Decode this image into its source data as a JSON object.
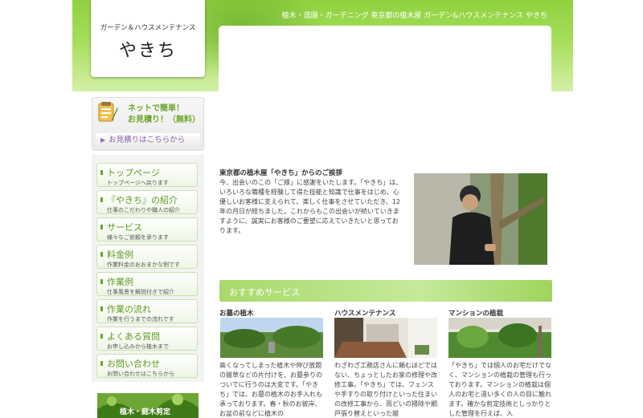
{
  "header": {
    "tagline": "植木・造園・ガーデニング 東京都の植木屋 ガーデン&ハウスメンテナンス やきち",
    "logo_sub": "ガーデン＆ハウスメンテナンス",
    "logo_main": "やきち"
  },
  "estimate": {
    "title_line1": "ネットで簡単！",
    "title_line2": "お見積り！（無料）",
    "link_label": "お見積りはこちらから"
  },
  "nav": [
    {
      "title": "トップページ",
      "sub": "トップページへ戻ります"
    },
    {
      "title": "『やきち』の紹介",
      "sub": "仕事のこだわりや職人の紹介"
    },
    {
      "title": "サービス",
      "sub": "様々なご依頼を承ります"
    },
    {
      "title": "料金例",
      "sub": "作業料金のおおまかな例です"
    },
    {
      "title": "作業例",
      "sub": "仕事風景を解説付きで紹介"
    },
    {
      "title": "作業の流れ",
      "sub": "作業を行うまでの流れです"
    },
    {
      "title": "よくある質問",
      "sub": "お申し込みから植木まで"
    },
    {
      "title": "お問い合わせ",
      "sub": "お問い合わせはこちらから"
    }
  ],
  "side_banner": {
    "label": "植木・庭木剪定"
  },
  "intro": {
    "title": "東京都の植木屋「やきち」からのご挨拶",
    "text": "今、出会いのこの「ご縁」に感謝をいたします。「やきち」は、いろいろな職種を経験して得た技能と知識で仕事をはじめ、心優しいお客様に支えられて、楽しく仕事をさせていただき、12年の月日が経ちました。これからもこの出会いが続いていきますように、誠実にお客様のご要望に応えていきたいと思っております。"
  },
  "recommend": {
    "title": "おすすめサービス",
    "services": [
      {
        "title": "お墓の植木",
        "text": "高くなってしまった植木や伸び放題の雑草などの片付けを、お墓参りのついでに行うのは大変です。「やきち」では、お墓の植木のお手入れも承っております。春・秋のお彼岸、お盆の前などに植木の"
      },
      {
        "title": "ハウスメンテナンス",
        "text": "わざわざ工務店さんに頼むほどではない、ちょっとしたお家の修理や改修工事。「やきち」では、フェンスや手すりの取り付けといった住まいの改修工事から、雨どいの掃除や網戸張り替えといった雑"
      },
      {
        "title": "マンションの植栽",
        "text": "「やきち」では個人のお宅だけでなく、マンションの植栽の管理も行っております。マンションの植栽は個人のお宅と違い多くの人の目に触れます。確かな剪定技術としっかりとした管理を行えば、入"
      }
    ]
  }
}
